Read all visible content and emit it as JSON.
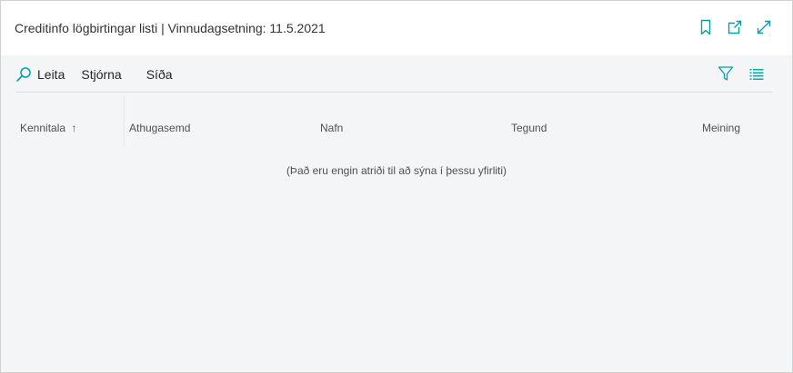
{
  "header": {
    "title": "Creditinfo lögbirtingar listi | Vinnudagsetning: 11.5.2021",
    "icons": [
      "bookmark-icon",
      "open-new-window-icon",
      "expand-icon"
    ]
  },
  "toolbar": {
    "search_label": "Leita",
    "manage_label": "Stjórna",
    "page_label": "Síða",
    "right_icons": [
      "filter-icon",
      "list-view-icon"
    ]
  },
  "table": {
    "columns": [
      {
        "label": "Kennitala",
        "sort": "↑"
      },
      {
        "label": "Athugasemd"
      },
      {
        "label": "Nafn"
      },
      {
        "label": "Tegund"
      },
      {
        "label": "Meining"
      }
    ],
    "empty_message": "(Það eru engin atriði til að sýna í þessu yfirliti)"
  },
  "colors": {
    "accent": "#00a1a8",
    "background": "#f4f5f7",
    "header_bg": "#ffffff",
    "text": "#333333"
  }
}
